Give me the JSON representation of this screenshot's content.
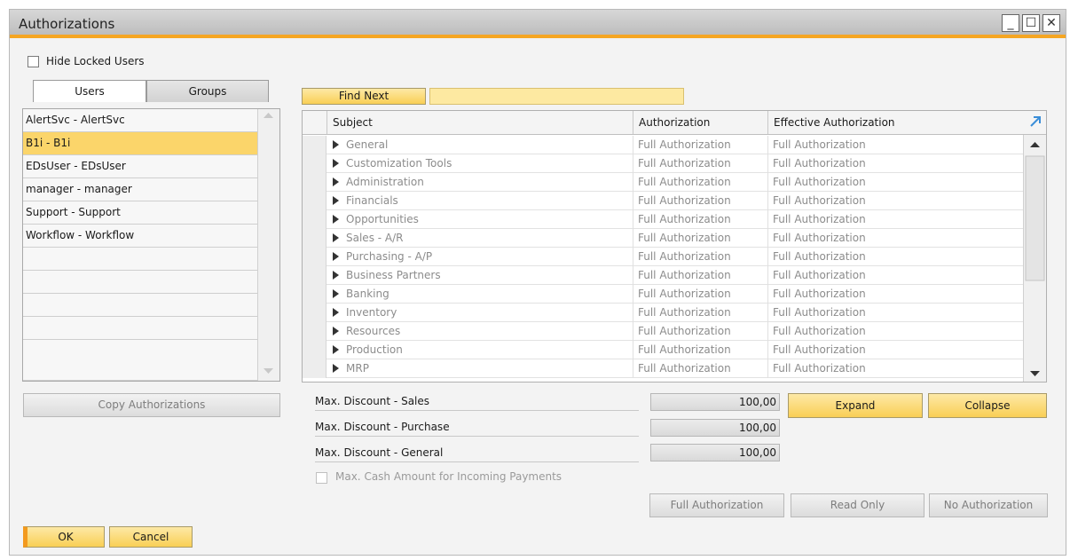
{
  "window": {
    "title": "Authorizations"
  },
  "hide_locked": {
    "label": "Hide Locked Users",
    "checked": false
  },
  "tabs": [
    {
      "label": "Users",
      "active": true
    },
    {
      "label": "Groups",
      "active": false
    }
  ],
  "users": [
    {
      "label": "AlertSvc - AlertSvc",
      "selected": false
    },
    {
      "label": "B1i - B1i",
      "selected": true
    },
    {
      "label": "EDsUser - EDsUser",
      "selected": false
    },
    {
      "label": "manager - manager",
      "selected": false
    },
    {
      "label": "Support - Support",
      "selected": false
    },
    {
      "label": "Workflow - Workflow",
      "selected": false
    }
  ],
  "copy_button": "Copy Authorizations",
  "find_next": {
    "label": "Find Next",
    "value": ""
  },
  "grid": {
    "headers": [
      "Subject",
      "Authorization",
      "Effective Authorization"
    ],
    "rows": [
      [
        "General",
        "Full Authorization",
        "Full Authorization"
      ],
      [
        "Customization Tools",
        "Full Authorization",
        "Full Authorization"
      ],
      [
        "Administration",
        "Full Authorization",
        "Full Authorization"
      ],
      [
        "Financials",
        "Full Authorization",
        "Full Authorization"
      ],
      [
        "Opportunities",
        "Full Authorization",
        "Full Authorization"
      ],
      [
        "Sales - A/R",
        "Full Authorization",
        "Full Authorization"
      ],
      [
        "Purchasing - A/P",
        "Full Authorization",
        "Full Authorization"
      ],
      [
        "Business Partners",
        "Full Authorization",
        "Full Authorization"
      ],
      [
        "Banking",
        "Full Authorization",
        "Full Authorization"
      ],
      [
        "Inventory",
        "Full Authorization",
        "Full Authorization"
      ],
      [
        "Resources",
        "Full Authorization",
        "Full Authorization"
      ],
      [
        "Production",
        "Full Authorization",
        "Full Authorization"
      ],
      [
        "MRP",
        "Full Authorization",
        "Full Authorization"
      ]
    ]
  },
  "discounts": [
    {
      "label": "Max. Discount - Sales",
      "value": "100,00"
    },
    {
      "label": "Max. Discount - Purchase",
      "value": "100,00"
    },
    {
      "label": "Max. Discount - General",
      "value": "100,00"
    }
  ],
  "max_cash": {
    "label": "Max. Cash Amount for Incoming Payments",
    "checked": false
  },
  "buttons": {
    "expand": "Expand",
    "collapse": "Collapse",
    "full_auth": "Full Authorization",
    "read_only": "Read Only",
    "no_auth": "No Authorization",
    "ok": "OK",
    "cancel": "Cancel"
  },
  "colors": {
    "accent": "#f5a623",
    "selected_row": "#fbd56a",
    "button_orange": "#f9cf55"
  },
  "icons": [
    "minimize-icon",
    "maximize-icon",
    "close-icon",
    "expand-arrow-icon",
    "scroll-up-icon",
    "scroll-down-icon",
    "row-expand-triangle-icon"
  ]
}
